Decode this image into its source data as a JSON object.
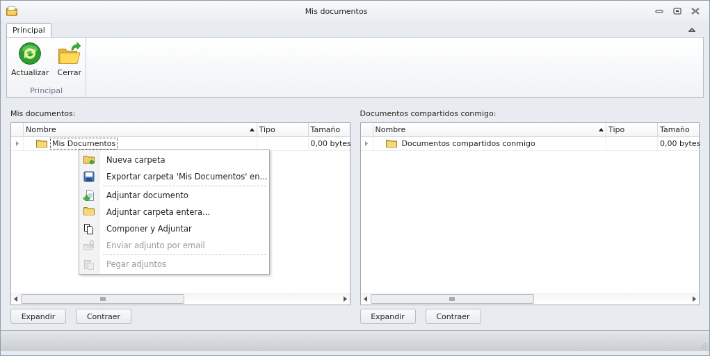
{
  "window": {
    "title": "Mis documentos"
  },
  "ribbon": {
    "tabs": [
      {
        "label": "Principal",
        "selected": true
      }
    ],
    "buttons": [
      {
        "label": "Actualizar",
        "kind": "refresh"
      },
      {
        "label": "Cerrar",
        "kind": "close"
      }
    ],
    "group_label": "Principal"
  },
  "panels": [
    {
      "title": "Mis documentos:",
      "columns": [
        "Nombre",
        "Tipo",
        "Tamaño"
      ],
      "rows": [
        {
          "name": "Mis Documentos",
          "size": "0,00 bytes",
          "focused": true
        }
      ],
      "buttons": [
        "Expandir",
        "Contraer"
      ]
    },
    {
      "title": "Documentos compartidos conmigo:",
      "columns": [
        "Nombre",
        "Tipo",
        "Tamaño"
      ],
      "rows": [
        {
          "name": "Documentos compartidos conmigo",
          "size": "0,00 bytes",
          "focused": false
        }
      ],
      "buttons": [
        "Expandir",
        "Contraer"
      ]
    }
  ],
  "context_menu": {
    "items": [
      {
        "label": "Nueva carpeta",
        "kind": "folder-add",
        "disabled": false,
        "separator_before": false
      },
      {
        "label": "Exportar carpeta 'Mis Documentos' en...",
        "kind": "save",
        "disabled": false,
        "separator_before": false
      },
      {
        "label": "Adjuntar documento",
        "kind": "doc-add",
        "disabled": false,
        "separator_before": true
      },
      {
        "label": "Adjuntar carpeta entera...",
        "kind": "folder",
        "disabled": false,
        "separator_before": false
      },
      {
        "label": "Componer y Adjuntar",
        "kind": "copy",
        "disabled": false,
        "separator_before": false
      },
      {
        "label": "Enviar adjunto por email",
        "kind": "mail",
        "disabled": true,
        "separator_before": false
      },
      {
        "label": "Pegar adjuntos",
        "kind": "paste",
        "disabled": true,
        "separator_before": true
      }
    ]
  }
}
